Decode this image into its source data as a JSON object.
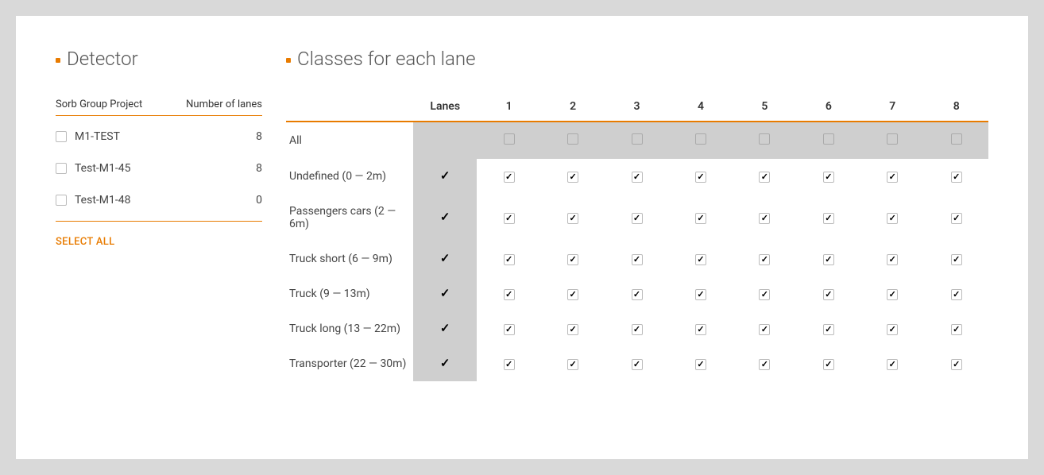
{
  "detector": {
    "title": "Detector",
    "col_project": "Sorb Group Project",
    "col_lanes": "Number of lanes",
    "rows": [
      {
        "name": "M1-TEST",
        "lanes": "8",
        "checked": false
      },
      {
        "name": "Test-M1-45",
        "lanes": "8",
        "checked": false
      },
      {
        "name": "Test-M1-48",
        "lanes": "0",
        "checked": false
      }
    ],
    "select_all": "SELECT ALL"
  },
  "classes": {
    "title": "Classes for each lane",
    "lanes_header": "Lanes",
    "lane_numbers": [
      "1",
      "2",
      "3",
      "4",
      "5",
      "6",
      "7",
      "8"
    ],
    "all_label": "All",
    "all_row_checks": [
      false,
      false,
      false,
      false,
      false,
      false,
      false,
      false
    ],
    "rows": [
      {
        "label": "Undefined (0 — 2m)",
        "all": true,
        "checks": [
          true,
          true,
          true,
          true,
          true,
          true,
          true,
          true
        ]
      },
      {
        "label": "Passengers cars (2 — 6m)",
        "all": true,
        "checks": [
          true,
          true,
          true,
          true,
          true,
          true,
          true,
          true
        ]
      },
      {
        "label": "Truck short (6 — 9m)",
        "all": true,
        "checks": [
          true,
          true,
          true,
          true,
          true,
          true,
          true,
          true
        ]
      },
      {
        "label": "Truck (9 — 13m)",
        "all": true,
        "checks": [
          true,
          true,
          true,
          true,
          true,
          true,
          true,
          true
        ]
      },
      {
        "label": "Truck long (13 — 22m)",
        "all": true,
        "checks": [
          true,
          true,
          true,
          true,
          true,
          true,
          true,
          true
        ]
      },
      {
        "label": "Transporter (22 — 30m)",
        "all": true,
        "checks": [
          true,
          true,
          true,
          true,
          true,
          true,
          true,
          true
        ]
      }
    ]
  }
}
